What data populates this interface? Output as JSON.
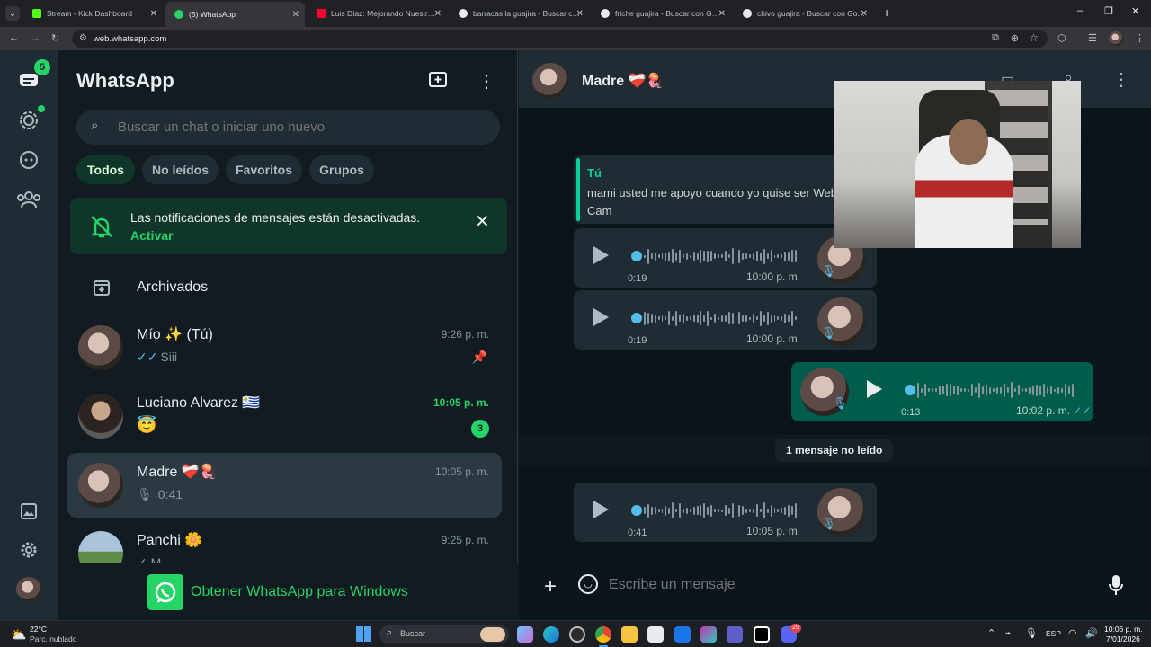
{
  "browser": {
    "tabs": [
      {
        "label": "Stream - Kick Dashboard",
        "favicon_color": "#53fc18"
      },
      {
        "label": "(5) WhatsApp",
        "favicon_color": "#25d366"
      },
      {
        "label": "Luis Díaz: Mejorando Nuestro Ingl",
        "favicon_color": "#ff0033"
      },
      {
        "label": "barracas la guajira - Buscar con G",
        "favicon_color": "#e8eaed"
      },
      {
        "label": "friche guajira - Buscar con Google",
        "favicon_color": "#e8eaed"
      },
      {
        "label": "chivo guajira - Buscar con Google",
        "favicon_color": "#e8eaed"
      }
    ],
    "url": "web.whatsapp.com",
    "new_tab_glyph": "+",
    "window_controls": [
      "–",
      "❐",
      "✕"
    ]
  },
  "rail": {
    "chats_badge": "5"
  },
  "sidebar": {
    "title": "WhatsApp",
    "search_placeholder": "Buscar un chat o iniciar uno nuevo",
    "filters": [
      "Todos",
      "No leídos",
      "Favoritos",
      "Grupos"
    ],
    "notice": {
      "text": "Las notificaciones de mensajes están desactivadas.",
      "action": "Activar"
    },
    "archived_label": "Archivados",
    "chats": [
      {
        "name": "Mío ✨ (Tú)",
        "time": "9:26 p. m.",
        "preview": "Siii",
        "ticks": "✓✓",
        "pinned": true
      },
      {
        "name": "Luciano Alvarez 🇺🇾",
        "time": "10:05 p. m.",
        "preview": "😇",
        "unread": "3"
      },
      {
        "name": "Madre ❤️‍🩹🪼",
        "time": "10:05 p. m.",
        "preview": "0:41"
      },
      {
        "name": "Panchi 🌼",
        "time": "9:25 p. m.",
        "preview": "✓ M"
      }
    ],
    "promo": "Obtener WhatsApp para Windows"
  },
  "chat": {
    "contact_name": "Madre ❤️‍🩹🪼",
    "quoted": {
      "author": "Tú",
      "text": "mami usted me apoyo cuando yo quise ser Web Cam"
    },
    "voice_messages": [
      {
        "duration": "0:19",
        "time": "10:00 p. m.",
        "direction": "in"
      },
      {
        "duration": "0:19",
        "time": "10:00 p. m.",
        "direction": "in"
      },
      {
        "duration": "0:13",
        "time": "10:02 p. m.",
        "direction": "out",
        "ticks": "✓✓"
      },
      {
        "duration": "0:41",
        "time": "10:05 p. m.",
        "direction": "in"
      }
    ],
    "unread_divider": "1 mensaje no leído",
    "composer_placeholder": "Escribe un mensaje"
  },
  "taskbar": {
    "weather_temp": "22°C",
    "weather_desc": "Parc. nublado",
    "search_label": "Buscar",
    "language": "ESP",
    "clock_time": "10:06 p. m.",
    "clock_date": "7/01/2026",
    "discord_badge": "29"
  }
}
